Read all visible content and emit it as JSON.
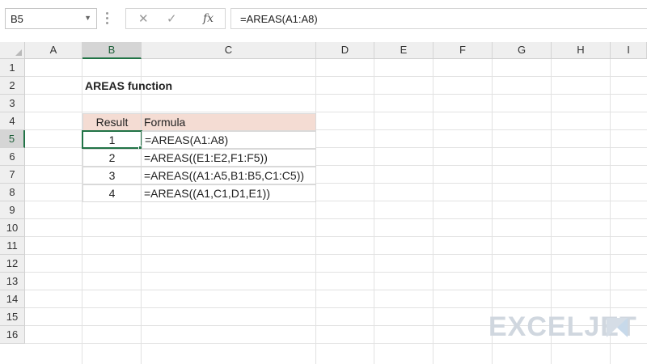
{
  "formula_bar": {
    "name_box": "B5",
    "cancel_icon": "✕",
    "enter_icon": "✓",
    "fx_label": "fx",
    "formula": "=AREAS(A1:A8)"
  },
  "columns": [
    "A",
    "B",
    "C",
    "D",
    "E",
    "F",
    "G",
    "H",
    "I"
  ],
  "rows": [
    "1",
    "2",
    "3",
    "4",
    "5",
    "6",
    "7",
    "8",
    "9",
    "10",
    "11",
    "12",
    "13",
    "14",
    "15",
    "16"
  ],
  "selected": {
    "column": "B",
    "row": "5",
    "cell": "B5"
  },
  "sheet": {
    "title": "AREAS function",
    "table": {
      "headers": [
        "Result",
        "Formula"
      ],
      "rows": [
        {
          "result": "1",
          "formula": "=AREAS(A1:A8)"
        },
        {
          "result": "2",
          "formula": "=AREAS((E1:E2,F1:F5))"
        },
        {
          "result": "3",
          "formula": "=AREAS((A1:A5,B1:B5,C1:C5))"
        },
        {
          "result": "4",
          "formula": "=AREAS((A1,C1,D1,E1))"
        }
      ]
    }
  },
  "watermark": {
    "text": "EXCELJET",
    "color": "#d0d7df"
  },
  "colors": {
    "accent": "#217346",
    "header_fill": "#f4dcd3"
  }
}
